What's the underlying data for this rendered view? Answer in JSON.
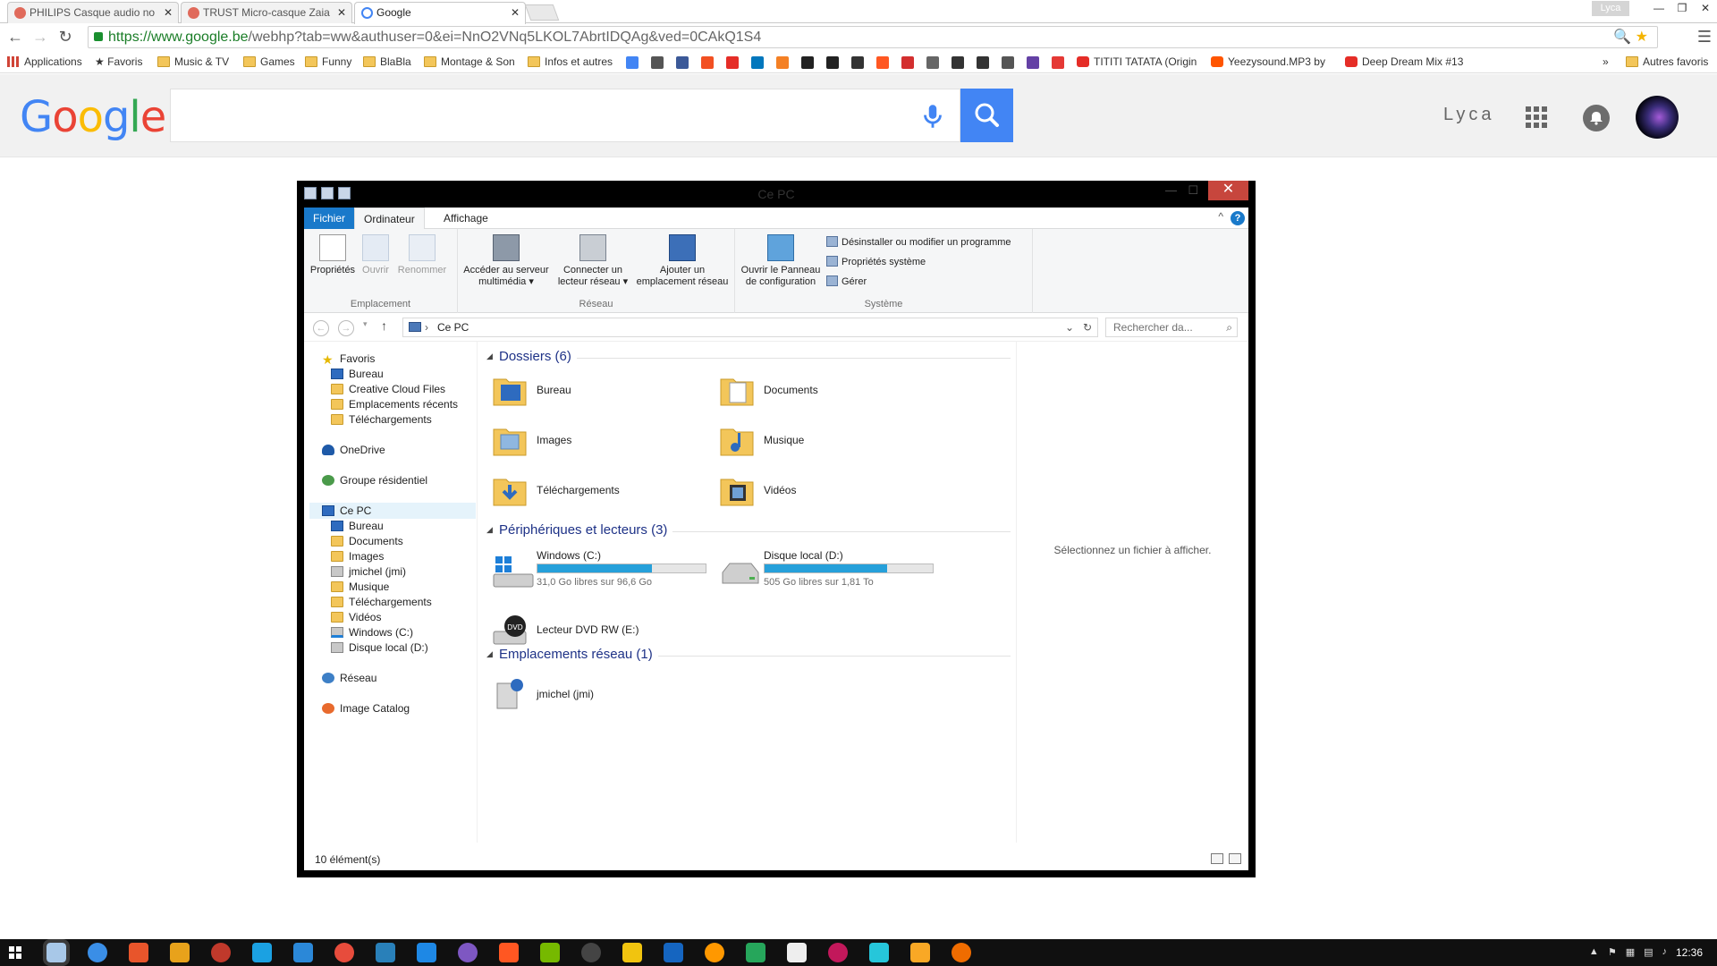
{
  "browser": {
    "tabs": [
      {
        "title": "PHILIPS Casque audio no",
        "favicon_color": "#e06a5b"
      },
      {
        "title": "TRUST Micro-casque Zaia",
        "favicon_color": "#e06a5b"
      },
      {
        "title": "Google",
        "favicon_color": "#4285f4",
        "active": true
      }
    ],
    "profile_name": "Lyca",
    "url_host": "https://www.google.be",
    "url_path": "/webhp?tab=ww&authuser=0&ei=NnO2VNq5LKOL7AbrtIDQAg&ved=0CAkQ1S4",
    "bookmarks": {
      "apps": "Applications",
      "favoris": "Favoris",
      "folders": [
        "Music & TV",
        "Games",
        "Funny",
        "BlaBla",
        "Montage & Son",
        "Infos et autres"
      ],
      "icon_colors": [
        "#4285f4",
        "#555555",
        "#3b5998",
        "#f25022",
        "#e52d27",
        "#0277bd",
        "#f48024",
        "#222222",
        "#222222",
        "#333333",
        "#ff5722",
        "#d32f2f",
        "#666666",
        "#333333",
        "#333333",
        "#555555",
        "#6441a5",
        "#e53935"
      ],
      "items": [
        {
          "label": "TITITI TATATA (Origin",
          "icon_color": "#e52d27"
        },
        {
          "label": "Yeezysound.MP3 by",
          "icon_color": "#ff5500"
        },
        {
          "label": "Deep Dream Mix #13",
          "icon_color": "#e52d27"
        }
      ],
      "more": "»",
      "other": "Autres favoris"
    }
  },
  "google": {
    "logo": "Google",
    "user": "Lyca",
    "logo_colors": [
      "#4285f4",
      "#ea4335",
      "#fbbc05",
      "#4285f4",
      "#34a853",
      "#ea4335"
    ]
  },
  "explorer": {
    "title": "Ce PC",
    "ribbon_tabs": {
      "file": "Fichier",
      "computer": "Ordinateur",
      "view": "Affichage"
    },
    "groups": {
      "emplacement": {
        "label": "Emplacement",
        "buttons": [
          "Propriétés",
          "Ouvrir",
          "Renommer"
        ]
      },
      "reseau": {
        "label": "Réseau",
        "buttons": [
          {
            "l1": "Accéder au serveur",
            "l2": "multimédia ▾"
          },
          {
            "l1": "Connecter un",
            "l2": "lecteur réseau ▾"
          },
          {
            "l1": "Ajouter un",
            "l2": "emplacement réseau"
          }
        ]
      },
      "systeme": {
        "label": "Système",
        "panel": {
          "l1": "Ouvrir le Panneau",
          "l2": "de configuration"
        },
        "small": [
          "Désinstaller ou modifier un programme",
          "Propriétés système",
          "Gérer"
        ]
      }
    },
    "address": "Ce PC",
    "search_placeholder": "Rechercher da...",
    "nav": {
      "favoris": "Favoris",
      "fav_items": [
        "Bureau",
        "Creative Cloud Files",
        "Emplacements récents",
        "Téléchargements"
      ],
      "onedrive": "OneDrive",
      "homegroup": "Groupe résidentiel",
      "thispc": "Ce PC",
      "pc_items": [
        "Bureau",
        "Documents",
        "Images",
        "jmichel (jmi)",
        "Musique",
        "Téléchargements",
        "Vidéos",
        "Windows (C:)",
        "Disque local (D:)"
      ],
      "network": "Réseau",
      "catalog": "Image Catalog"
    },
    "sections": {
      "folders": "Dossiers (6)",
      "devices": "Périphériques et lecteurs (3)",
      "netloc": "Emplacements réseau (1)"
    },
    "folders": [
      "Bureau",
      "Documents",
      "Images",
      "Musique",
      "Téléchargements",
      "Vidéos"
    ],
    "drives": [
      {
        "name": "Windows (C:)",
        "free": "31,0 Go libres sur 96,6 Go",
        "used_fraction": 0.68
      },
      {
        "name": "Disque local (D:)",
        "free": "505 Go libres sur 1,81 To",
        "used_fraction": 0.73
      }
    ],
    "dvd": "Lecteur DVD RW (E:)",
    "net_item": "jmichel (jmi)",
    "preview_text": "Sélectionnez un fichier à afficher.",
    "status": "10 élément(s)"
  },
  "taskbar": {
    "time": "12:36",
    "app_colors": [
      "#a8c8e8",
      "#3a8ee6",
      "#e8552b",
      "#e8a21b",
      "#c0392b",
      "#1ba1e2",
      "#2b88d8",
      "#e74c3c",
      "#2980b9",
      "#1e88e5",
      "#7e57c2",
      "#ff5722",
      "#76b900",
      "#444444",
      "#f1c40f",
      "#1565c0",
      "#ff9800",
      "#26a65b",
      "#eeeeee",
      "#c2185b",
      "#26c6da",
      "#f9a825",
      "#ef6c00"
    ]
  }
}
